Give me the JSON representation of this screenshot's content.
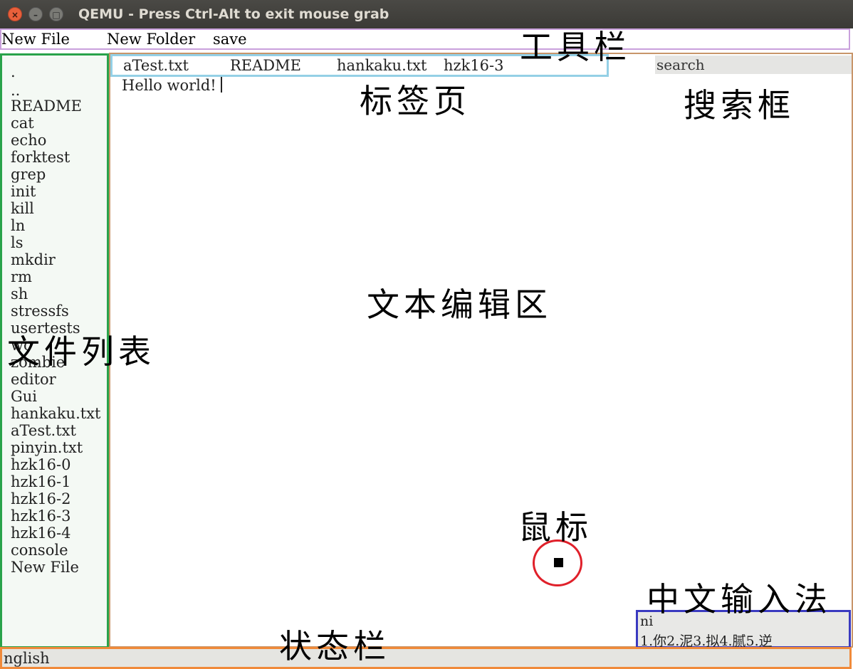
{
  "window": {
    "title": "QEMU - Press Ctrl-Alt to exit mouse grab"
  },
  "toolbar": {
    "items": [
      "New File",
      "New Folder",
      "save"
    ]
  },
  "file_list": {
    "items": [
      ".",
      "..",
      "README",
      "cat",
      "echo",
      "forktest",
      "grep",
      "init",
      "kill",
      "ln",
      "ls",
      "mkdir",
      "rm",
      "sh",
      "stressfs",
      "usertests",
      "wc",
      "zombie",
      "editor",
      "Gui",
      "hankaku.txt",
      "aTest.txt",
      "pinyin.txt",
      "hzk16-0",
      "hzk16-1",
      "hzk16-2",
      "hzk16-3",
      "hzk16-4",
      "console",
      "New File"
    ]
  },
  "tabs": {
    "items": [
      "aTest.txt",
      "README",
      "hankaku.txt",
      "hzk16-3"
    ]
  },
  "search": {
    "placeholder": "search"
  },
  "editor": {
    "content": "Hello world!"
  },
  "ime": {
    "input": "ni",
    "candidates": "1.你2.泥3.拟4.腻5.逆"
  },
  "status": {
    "text": "nglish"
  },
  "annotations": {
    "toolbar": "工具栏",
    "tabs": "标签页",
    "search": "搜索框",
    "editor": "文本编辑区",
    "file_list": "文件列表",
    "mouse": "鼠标",
    "ime": "中文输入法",
    "status": "状态栏"
  },
  "colors": {
    "toolbar_box": "#c9a0dc",
    "file_list_box": "#29a34a",
    "tabs_box": "#94d0e6",
    "editor_box": "#c8956a",
    "ime_box": "#3a3ac0",
    "status_box": "#f08a3a",
    "mouse_ring": "#e0202a"
  }
}
